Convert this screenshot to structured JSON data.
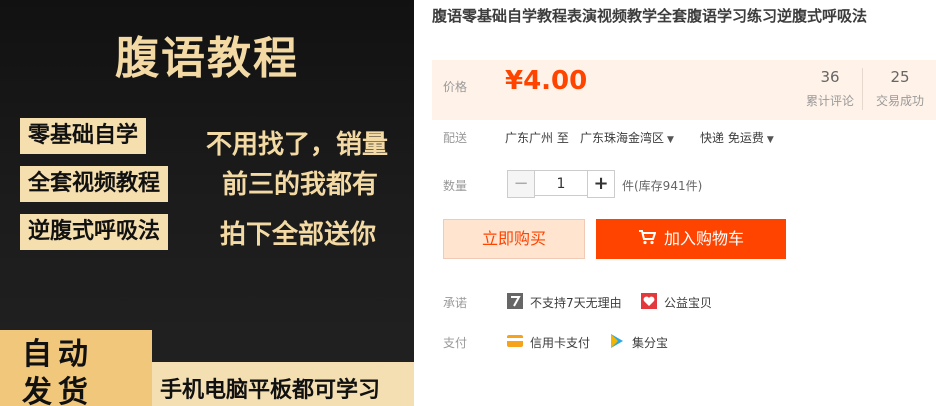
{
  "banner": {
    "title": "腹语教程",
    "tags": [
      "零基础自学",
      "全套视频教程",
      "逆腹式呼吸法"
    ],
    "slogans": [
      "不用找了，销量",
      "前三的我都有",
      "拍下全部送你"
    ],
    "auto_line1": "自动",
    "auto_line2": "发货",
    "device_text": "手机电脑平板都可学习"
  },
  "product": {
    "title": "腹语零基础自学教程表演视频教学全套腹语学习练习逆腹式呼吸法",
    "price_label": "价格",
    "price": "¥4.00",
    "stats": [
      {
        "value": "36",
        "label": "累计评论"
      },
      {
        "value": "25",
        "label": "交易成功"
      }
    ],
    "shipping": {
      "label": "配送",
      "from": "广东广州 至",
      "to": "广东珠海金湾区",
      "method": "快递 免运费"
    },
    "quantity": {
      "label": "数量",
      "minus": "−",
      "value": "1",
      "plus": "+",
      "stock": "件(库存941件)"
    },
    "buttons": {
      "buy_now": "立即购买",
      "add_to_cart": "加入购物车"
    },
    "promise": {
      "label": "承诺",
      "items": [
        {
          "icon": "seven-day-icon",
          "text": "不支持7天无理由"
        },
        {
          "icon": "charity-icon",
          "text": "公益宝贝"
        }
      ]
    },
    "payment": {
      "label": "支付",
      "items": [
        {
          "icon": "credit-card-icon",
          "text": "信用卡支付"
        },
        {
          "icon": "jifenbao-icon",
          "text": "集分宝"
        }
      ]
    }
  },
  "colors": {
    "accent": "#ff4400",
    "price_bg": "#fff2e8",
    "gold": "#f3d9a3"
  }
}
